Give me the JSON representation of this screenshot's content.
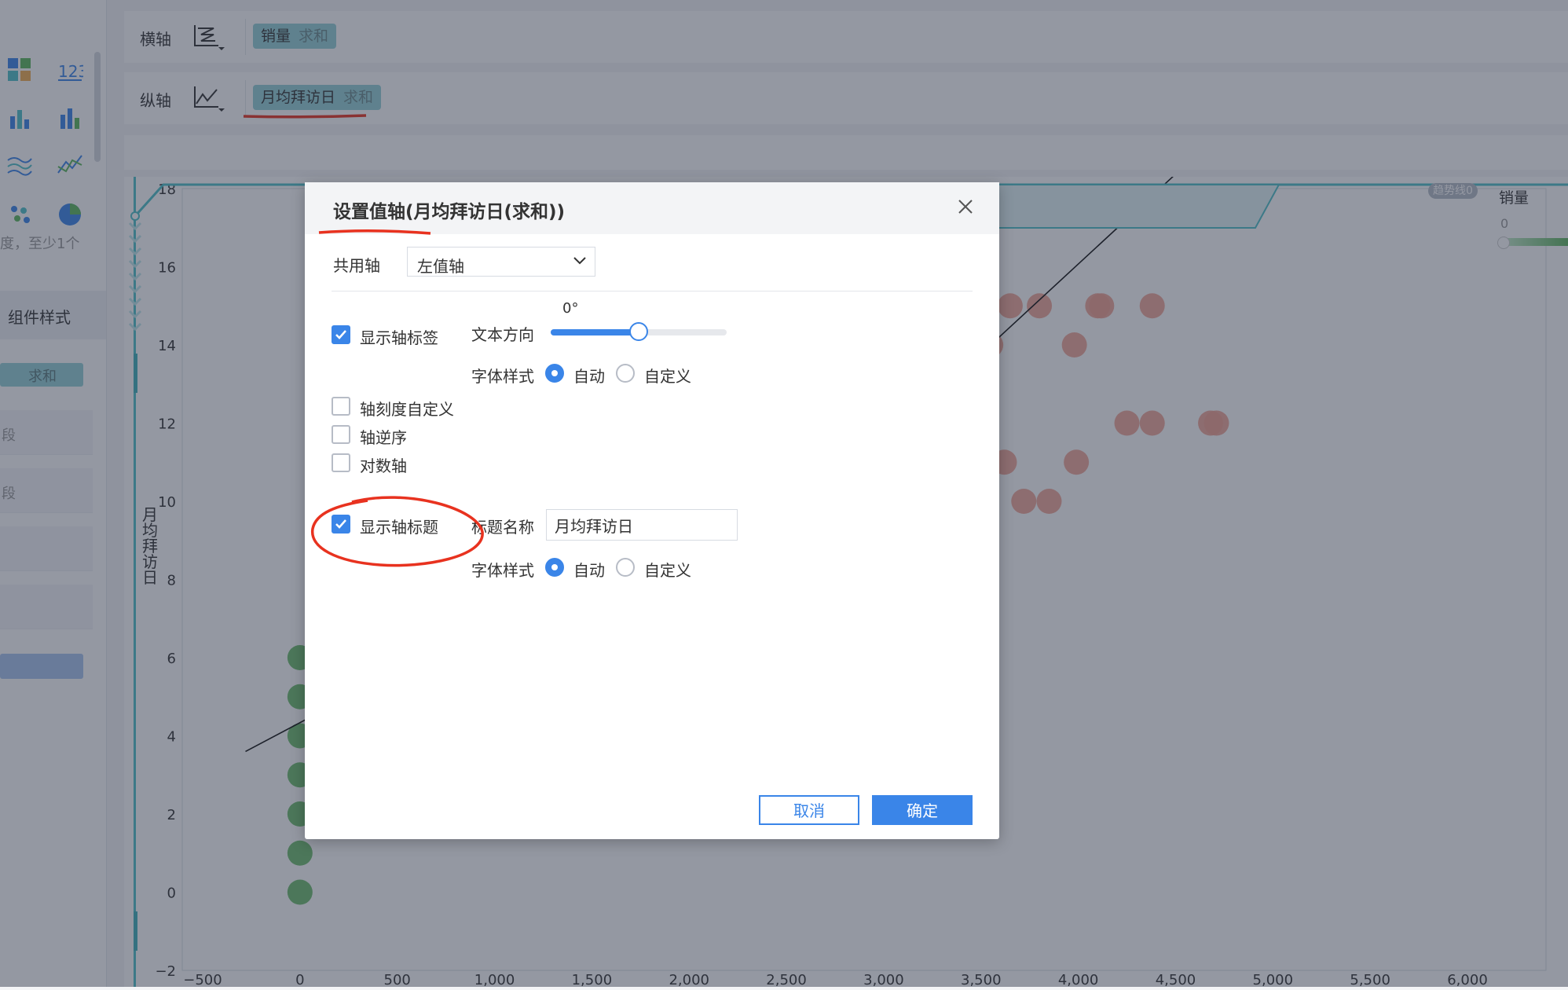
{
  "toolbar": {
    "x_axis_label": "横轴",
    "y_axis_label": "纵轴",
    "x_field": {
      "name": "销量",
      "agg": "求和"
    },
    "y_field": {
      "name": "月均拜访日",
      "agg": "求和"
    }
  },
  "left_panel": {
    "hint": "度，至少1个",
    "section_title": "组件样式",
    "pill_label": "求和",
    "row1": "段",
    "row2": "段"
  },
  "chart_data": {
    "type": "scatter",
    "ylabel": "月均拜访日",
    "legend_title": "销量",
    "legend_min": "0",
    "trend_tag": "趋势线0",
    "x_ticks": [
      "−500",
      "0",
      "500",
      "1,000",
      "1,500",
      "2,000",
      "2,500",
      "3,000",
      "3,500",
      "4,000",
      "4,500",
      "5,000",
      "5,500",
      "6,000"
    ],
    "y_ticks": [
      "18",
      "16",
      "14",
      "12",
      "10",
      "8",
      "6",
      "4",
      "2",
      "0",
      "−2"
    ],
    "xlim": [
      -500,
      6000
    ],
    "ylim": [
      -2,
      18
    ],
    "series": [
      {
        "color": "#5fb55f",
        "points": [
          [
            0,
            6
          ],
          [
            0,
            5
          ],
          [
            0,
            4
          ],
          [
            0,
            3
          ],
          [
            0,
            2
          ],
          [
            0,
            1
          ],
          [
            0,
            0
          ]
        ]
      },
      {
        "color": "#f0a090",
        "points": [
          [
            3650,
            15
          ],
          [
            3800,
            15
          ],
          [
            4100,
            15
          ],
          [
            4120,
            15
          ],
          [
            4380,
            15
          ],
          [
            3550,
            14
          ],
          [
            3980,
            14
          ],
          [
            4250,
            12
          ],
          [
            4380,
            12
          ],
          [
            4680,
            12
          ],
          [
            4710,
            12
          ],
          [
            3620,
            11
          ],
          [
            3990,
            11
          ],
          [
            3520,
            10
          ],
          [
            3720,
            10
          ],
          [
            3850,
            10
          ]
        ]
      }
    ],
    "trendline": [
      [
        -280,
        3.6
      ],
      [
        100,
        4.6
      ],
      [
        3550,
        14
      ],
      [
        4550,
        18.6
      ]
    ]
  },
  "dialog": {
    "title": "设置值轴(月均拜访日(求和))",
    "shared_axis_label": "共用轴",
    "shared_axis_value": "左值轴",
    "show_axis_label": "显示轴标签",
    "text_direction_label": "文本方向",
    "text_direction_value": "0°",
    "text_direction_fraction": 0.5,
    "font_style_label": "字体样式",
    "font_auto": "自动",
    "font_custom": "自定义",
    "custom_ticks": "轴刻度自定义",
    "reverse_axis": "轴逆序",
    "log_axis": "对数轴",
    "show_axis_title": "显示轴标题",
    "title_name_label": "标题名称",
    "title_name_value": "月均拜访日",
    "font_style_label2": "字体样式",
    "font_auto2": "自动",
    "font_custom2": "自定义",
    "cancel": "取消",
    "ok": "确定"
  },
  "colors": {
    "accent": "#3a85e8",
    "annotation": "#e8321f",
    "teal": "#4fc1c9"
  }
}
